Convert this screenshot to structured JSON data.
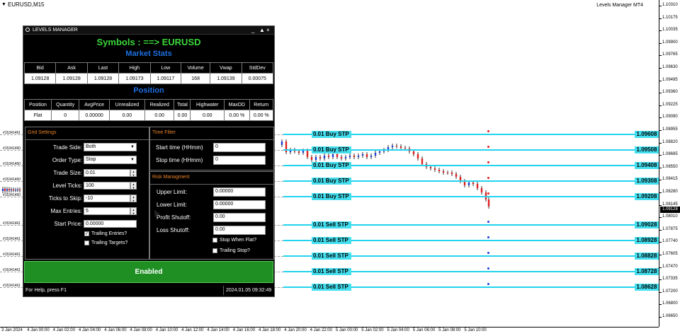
{
  "chart": {
    "symbol": "EURUSD,M15",
    "indicator": "Levels Manager MT4",
    "current_price": "1.09128",
    "price_ticks": [
      "1.10310",
      "1.10175",
      "1.10035",
      "1.09900",
      "1.09765",
      "1.09630",
      "1.09495",
      "1.09360",
      "1.09225",
      "1.09090",
      "1.08955",
      "1.08820",
      "1.08685",
      "1.08550",
      "1.08415",
      "1.08280",
      "1.08145",
      "1.08010",
      "1.07875",
      "1.07740",
      "1.07605",
      "1.07470",
      "1.07335",
      "1.07200",
      "1.06800",
      "1.06650"
    ],
    "time_ticks": [
      "3 Jan 2024",
      "4 Jan 00:00",
      "4 Jan 02:00",
      "4 Jan 04:00",
      "4 Jan 06:00",
      "4 Jan 08:00",
      "4 Jan 10:00",
      "4 Jan 12:00",
      "4 Jan 14:00",
      "4 Jan 16:00",
      "4 Jan 18:00",
      "4 Jan 20:00",
      "4 Jan 22:00",
      "5 Jan 00:00",
      "5 Jan 02:00",
      "5 Jan 04:00",
      "5 Jan 06:00",
      "5 Jan 08:00",
      "5 Jan 10:00"
    ],
    "levels": [
      {
        "label": "0.01 Buy STP",
        "price": "1.09608"
      },
      {
        "label": "0.01 Buy STP",
        "price": "1.09508"
      },
      {
        "label": "0.01 Buy STP",
        "price": "1.09408"
      },
      {
        "label": "0.01 Buy STP",
        "price": "1.09308"
      },
      {
        "label": "0.01 Buy STP",
        "price": "1.09208"
      },
      {
        "label": "0.01 Sell STP",
        "price": "1.09028"
      },
      {
        "label": "0.01 Sell STP",
        "price": "1.08928"
      },
      {
        "label": "0.01 Sell STP",
        "price": "1.08828"
      },
      {
        "label": "0.01 Sell STP",
        "price": "1.08728"
      },
      {
        "label": "0.01 Sell STP",
        "price": "1.08628"
      }
    ],
    "left_order_labels": [
      "#15341461",
      "#15341460",
      "#15341460",
      "#15341460",
      "#15341460",
      "#15341461",
      "#15341461",
      "#15341461",
      "#15341461",
      "#15341461"
    ],
    "colors": {
      "level": "#22d3ee",
      "bull": "#1e3fd6",
      "bear": "#e02020"
    }
  },
  "panel": {
    "title": "LEVELS MANAGER",
    "controls": [
      "_",
      "▲",
      "×"
    ],
    "symbols_text": "Symbols : ==> EURUSD",
    "market_stats_title": "Market Stats",
    "market_stats": {
      "headers": [
        "Bid",
        "Ask",
        "Last",
        "High",
        "Low",
        "Volume",
        "Vwap",
        "StdDev"
      ],
      "values": [
        "1.09128",
        "1.09128",
        "1.09128",
        "1.09173",
        "1.09117",
        "168",
        "1.09139",
        "0.00075"
      ]
    },
    "position_title": "Position",
    "position": {
      "headers": [
        "Position",
        "Quantity",
        "AvgPrice",
        "Unrealized",
        "Realized",
        "Total",
        "Highwater",
        "MaxDD",
        "Return"
      ],
      "values": [
        "Flat",
        "0",
        "0.00000",
        "0.00",
        "0.00",
        "0.00",
        "0.00",
        "0.00 %",
        "0.00 %"
      ]
    },
    "grid_settings": {
      "title": "Grid Settings",
      "trade_side_label": "Trade Side:",
      "trade_side": "Both",
      "order_type_label": "Order Type:",
      "order_type": "Stop",
      "trade_size_label": "Trade Size:",
      "trade_size": "0.01",
      "level_ticks_label": "Level Ticks:",
      "level_ticks": "100",
      "ticks_to_skip_label": "Ticks to Skip:",
      "ticks_to_skip": "-10",
      "max_entries_label": "Max Entries:",
      "max_entries": "5",
      "start_price_label": "Start Price:",
      "start_price": "0.00000",
      "trailing_entries": "Trailing Entries?",
      "trailing_entries_checked": true,
      "trailing_targets": "Trailing Targets?",
      "trailing_targets_checked": false
    },
    "time_filter": {
      "title": "Time Filter",
      "start_label": "Start time (HHmm)",
      "start": "0",
      "stop_label": "Stop time (HHmm)",
      "stop": "0"
    },
    "risk": {
      "title": "Risk Managment",
      "upper_label": "Upper Limit:",
      "upper": "0.00000",
      "lower_label": "Lower Limit:",
      "lower": "0.00000",
      "profit_label": "Profit Shutoff:",
      "profit": "0.00",
      "loss_label": "Loss Shutoff:",
      "loss": "0.00",
      "stop_when_flat": "Stop When Flat?",
      "trailing_stop": "Trailing Stop?"
    },
    "enabled_label": "Enabled",
    "status_help": "For Help, press F1",
    "status_time": "2024.01.05 09:32:49"
  }
}
